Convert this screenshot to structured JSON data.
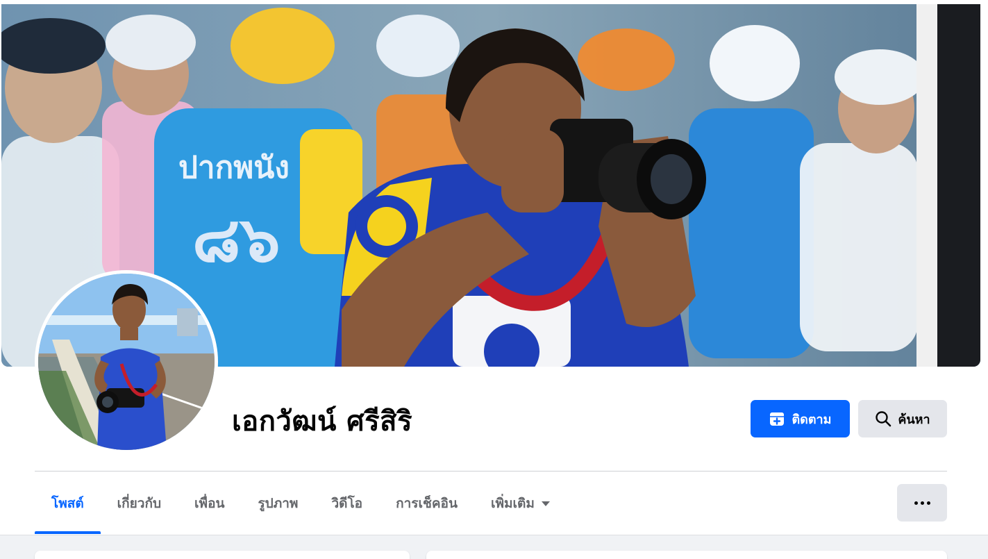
{
  "profile": {
    "name": "เอกวัฒน์ ศรีสิริ",
    "cover_alt": "cover-photo-photographer-with-camera-at-cycling-event",
    "avatar_alt": "profile-photo-man-with-camera-on-bridge"
  },
  "actions": {
    "follow_label": "ติดตาม",
    "search_label": "ค้นหา"
  },
  "tabs": [
    {
      "label": "โพสต์",
      "active": true
    },
    {
      "label": "เกี่ยวกับ",
      "active": false
    },
    {
      "label": "เพื่อน",
      "active": false
    },
    {
      "label": "รูปภาพ",
      "active": false
    },
    {
      "label": "วิดีโอ",
      "active": false
    },
    {
      "label": "การเช็คอิน",
      "active": false
    },
    {
      "label": "เพิ่มเติม",
      "active": false
    }
  ],
  "colors": {
    "accent": "#0866ff",
    "button_secondary": "#e4e6eb",
    "text_primary": "#050505",
    "text_secondary": "#65676b",
    "feed_background": "#f0f2f5"
  },
  "icons": {
    "follow": "user-plus-badge-icon",
    "search": "magnifier-icon",
    "more_tab": "caret-down-icon",
    "more_menu": "three-dots-icon"
  }
}
